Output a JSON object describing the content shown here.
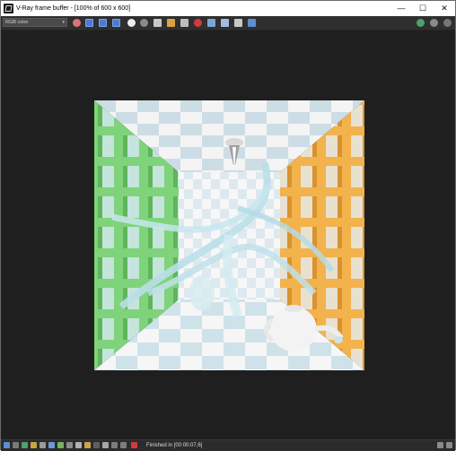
{
  "window": {
    "title": "V-Ray frame buffer - [100% of 600 x 600]",
    "minimize_glyph": "—",
    "maximize_glyph": "☐",
    "close_glyph": "✕"
  },
  "toolbar": {
    "channel_value": "RGB color",
    "channel_dropdown_glyph": "▾"
  },
  "statusbar": {
    "status_text": "Finished in [00:00:07,6]"
  },
  "colors": {
    "left_wall": "#7fd37a",
    "right_wall": "#f2b24c",
    "checker_white": "#f6f6f6",
    "glass": "#b9dfe8",
    "accent_blue": "#4a7bd8",
    "accent_red": "#d23b3b"
  }
}
